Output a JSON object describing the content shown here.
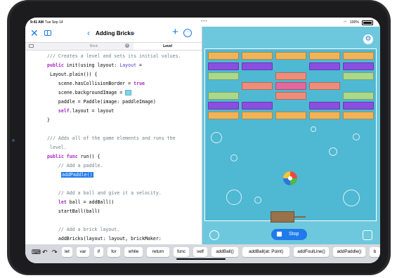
{
  "status_bar": {
    "time": "9:41 AM",
    "date": "Tue Sep 14",
    "dots": "•••",
    "battery": "100%"
  },
  "navigation": {
    "title": "Adding Bricks"
  },
  "tabs": {
    "tab1": "Brick",
    "tab2": "Level"
  },
  "code": [
    {
      "comment": "/// Creates a level and sets its initial values."
    },
    {
      "kw": "public",
      "fn": " init(using layout: ",
      "type": "Layout",
      "rest": " ="
    },
    {
      "text": " Layout.plain()) {"
    },
    {
      "text": "    scene.hasCollisionBorder = ",
      "kw": "true"
    },
    {
      "text": "    scene.backgroundImage = "
    },
    {
      "text": "    paddle = Paddle(image: paddleImage)"
    },
    {
      "kw": "    self",
      "text": ".layout = layout"
    },
    {
      "text": "}"
    },
    {
      "comment": "/// Adds all of the game elements and runs the"
    },
    {
      "comment": " level."
    },
    {
      "kw": "public",
      "kw2": " func",
      "text": " run() {"
    },
    {
      "comment": "    // Add a paddle."
    },
    {
      "selected": "addPaddle()"
    },
    {
      "comment": "    // Add a ball and give it a velocity."
    },
    {
      "kw": "    let",
      "text": " ball = addBall()"
    },
    {
      "text": "    startBall(ball)"
    },
    {
      "comment": "    // Add a brick layout."
    },
    {
      "text": "    addBricks(layout: layout, brickMaker:"
    }
  ],
  "live_view": {
    "stop_label": "Stop",
    "accent": "#1f7aeb"
  },
  "keyboard_bar": {
    "items": [
      "let",
      "var",
      "if",
      "for",
      "while",
      "return",
      "func",
      "self",
      "addBall()",
      "addBall(at: Point)",
      "addFoulLine()",
      "addPaddle()",
      "b"
    ]
  },
  "colors": {
    "water": "#6ec8dd",
    "orange": "#f0b458",
    "purple": "#8a4fe0",
    "green": "#a9d98a",
    "salmon": "#ee8e7a",
    "pink": "#e36a9a"
  }
}
